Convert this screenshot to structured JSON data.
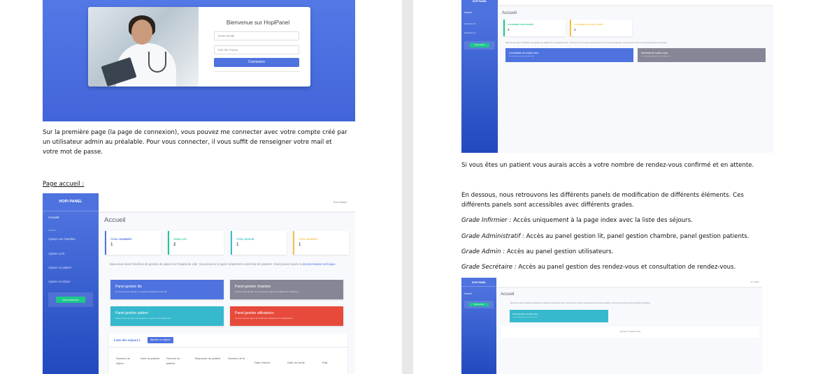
{
  "login": {
    "title": "Bienvenue sur HopiPanel",
    "email_placeholder": "Enter Email",
    "password_placeholder": "Mot De Passe",
    "button": "Connexion"
  },
  "text": {
    "login_para_1": "Sur la première page (la page de connexion), vous pouvez me connecter avec votre compte créé par",
    "login_para_2": "un utilisateur admin au préalable. Pour vous connecter, il vous suffit de renseigner votre mail et",
    "login_para_3": "votre mot de passe.",
    "home_heading": "Page accueil :",
    "patient_para": "Si vous êtes un patient vous aurais accès a votre nombre de rendez-vous confirmé et en attente.",
    "panels_para_1": "En dessous, nous retrouvons les différents panels de modification de différents éléments. Ces",
    "panels_para_2": "différents panels sont accessibles avec différents grades.",
    "grade_infirmier_label": "Grade Infirmier :",
    "grade_infirmier_text": " Accès uniquement à la page index avec la liste des séjours.",
    "grade_admin_label": "Grade Administratif :",
    "grade_admin_text": " Accès au panel gestion lit, panel gestion chambre, panel gestion patients.",
    "grade_admin2_label": "Grade Admin :",
    "grade_admin2_text": " Accès au panel gestion utilisateurs.",
    "grade_secretaire_label": "Grade Secrétaire :",
    "grade_secretaire_text": " Accès au panel gestion des rendez-vous et consultation de rendez-vous."
  },
  "admin_dashboard": {
    "brand": "HOPI PANEL",
    "user": "Tom Walyn",
    "title": "Accueil",
    "sidebar": {
      "active": "Accueil",
      "heading": "PANELS",
      "links": [
        "Ajouter une chambre",
        "Ajouter un lit",
        "Ajouter un patient",
        "Ajouter un séjour"
      ],
      "logout": "Déconnexion"
    },
    "stats": [
      {
        "label": "TOTAL CHAMBRES",
        "value": "1",
        "color": "#4e73df"
      },
      {
        "label": "TOTAL LITS",
        "value": "2",
        "color": "#1cc88a"
      },
      {
        "label": "TOTAL SÉJOUR",
        "value": "1",
        "color": "#36b9cc"
      },
      {
        "label": "TOTAL PATIENTS",
        "value": "1",
        "color": "#f6c23e"
      }
    ],
    "intro_1": "Bienvenue dans l'interface de gestion de patient de l'Hopital de Lille. Vous pourrez ici gerer simplement votre liste de patients. Vous",
    "intro_2_prefix": "pouvez suivre la ",
    "intro_2_link": "documentation technique",
    "intro_2_suffix": ".",
    "panels": [
      {
        "title": "Panel gestion lits",
        "sub": "Ici vous pourrez ajouter et supprimer facilement des lits.",
        "color": "#4e73df"
      },
      {
        "title": "Panel gestion chambre",
        "sub": "Comme pour les lits, ici vous pourrez gérer les différentes chambres.",
        "color": "#858796"
      },
      {
        "title": "Panel gestion patient",
        "sub": "C'est ici que l'on gère les patients ou ajout ou les supprimer.",
        "color": "#36b9cc"
      },
      {
        "title": "Panel gestion utilisateurs",
        "sub": "Ici vous pourrez gérer les différents utilisateurs de l'application.",
        "color": "#e74a3b"
      }
    ],
    "table": {
      "title": "Liste des séjours |",
      "button": "Ajouter un séjour",
      "columns": [
        "Numéro de séjour",
        "Nom du patient",
        "Prenom du patient",
        "Telephone du patient",
        "Numéro de lit",
        "Date d'arrivé",
        "Date de sortie",
        "Etat"
      ]
    }
  },
  "patient_dashboard": {
    "brand": "HOPI PANEL",
    "title": "Accueil",
    "sidebar": {
      "active": "Accueil",
      "links": [
        "Consulter ma",
        "Demander un"
      ],
      "logout": "Déconnexion"
    },
    "cards": [
      {
        "label": "VOS RENDEZ-VOUS VALIDÉS",
        "value": "3",
        "color": "#1cc88a"
      },
      {
        "label": "VOS RENDEZ-VOUS EN ATTENTE",
        "value": "2",
        "color": "#f6c23e"
      }
    ],
    "intro": "Bienvenue dans l'interface de gestion de patient de l'Hopital de Lille. Vous pourrez ici gerer simplement votre liste de patients. Vous pouvez suivre la documentation technique.",
    "panels": [
      {
        "title": "Consultation de rendez-vous",
        "sub": "Ici vous pourrez voir vos rendez-vous.",
        "color": "#4e73df"
      },
      {
        "title": "Demande de rendez-vous",
        "sub": "Ici vous pourrez demander un rendez-vous.",
        "color": "#858796"
      }
    ]
  },
  "secretary_dashboard": {
    "brand": "HOPI PANEL",
    "user": "Tom Walyn",
    "title": "Accueil",
    "sidebar": {
      "active": "Accueil",
      "logout": "Déconnexion"
    },
    "intro": "Bienvenue dans l'interface de gestion de patient de l'Hopital de Lille. Vous pourrez ici gerer simplement votre liste de patients. Vous pouvez suivre la documentation technique.",
    "panel": {
      "title": "Panel gestion rendez-vous",
      "sub": "Ici vous pourrez gérer les rendez-vous."
    },
    "footer": "Copyright © HopiPanel 2021"
  }
}
